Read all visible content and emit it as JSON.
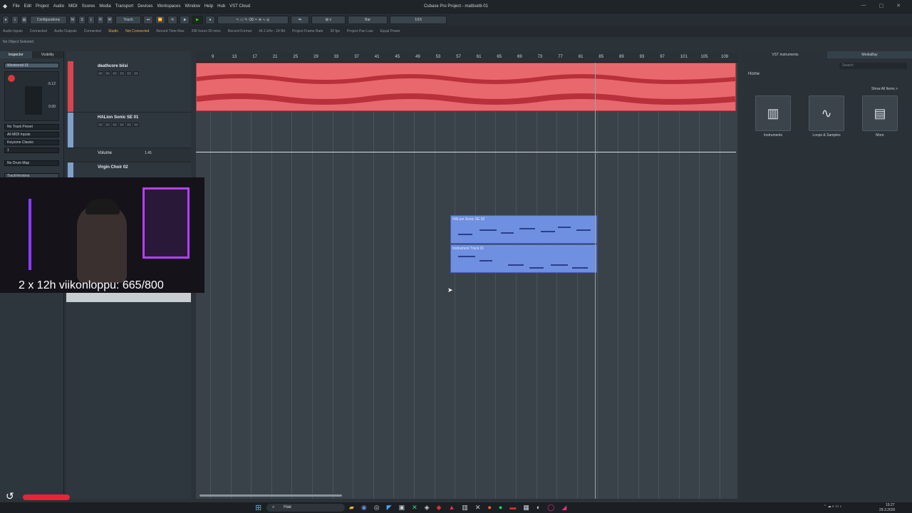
{
  "window": {
    "title": "Cubase Pro Project - mattisetti-01",
    "controls": [
      "—",
      "▢",
      "✕"
    ]
  },
  "menu": [
    "File",
    "Edit",
    "Project",
    "Audio",
    "MIDI",
    "Scores",
    "Media",
    "Transport",
    "Devices",
    "Workspaces",
    "Window",
    "Help",
    "Hub",
    "VST Cloud"
  ],
  "toolbar": {
    "configurations": "Configurations",
    "touch": "Touch",
    "snap_type": "Bar",
    "quantize": "1/16"
  },
  "status_line": {
    "audio_inputs": "Audio Inputs",
    "connected_1": "Connected",
    "audio_outputs": "Audio Outputs",
    "connected_2": "Connected",
    "studio": "Studio",
    "not_connected": "Not Connected",
    "record_time": "Record Time Max",
    "record_time_value": "296 hours 00 mins",
    "record_format": "Record Format",
    "record_format_value": "44.1 kHz - 24 Bit",
    "frame_rate": "Project Frame Rate",
    "frame_rate_value": "30 fps",
    "pan_law": "Project Pan Law",
    "pan_law_value": "Equal Power"
  },
  "selection_info": "No Object Selected",
  "inspector": {
    "tab_inspector": "Inspector",
    "tab_visibility": "Visibility",
    "track_name": "Westwood 01",
    "volume_value": "-5.12",
    "pan_value": "0.00",
    "no_track_preset": "No Track Preset",
    "midi_inputs": "All MIDI Inputs",
    "keyzone": "Keyzone Classic",
    "channel": "1",
    "no_drum_map": "No Drum Map",
    "track_versions": "TrackVersions"
  },
  "tracks": [
    {
      "name": "deathcore biisi",
      "color": "#d9454f"
    },
    {
      "name": "HALion Sonic SE 01",
      "color": "#7fa0c8"
    },
    {
      "name": "Volume",
      "automation_value": "1.45"
    },
    {
      "name": "Virgin Choir 02",
      "color": "#7fa0c8"
    }
  ],
  "ruler_ticks": [
    "9",
    "13",
    "17",
    "21",
    "25",
    "29",
    "33",
    "37",
    "41",
    "45",
    "49",
    "53",
    "57",
    "61",
    "65",
    "69",
    "73",
    "77",
    "81",
    "85",
    "89",
    "93",
    "97",
    "101",
    "105",
    "109"
  ],
  "parts": [
    {
      "label": "HALion Sonic SE 02"
    },
    {
      "label": "Instrument Track 01"
    }
  ],
  "right_panel": {
    "tab_vst": "VST Instruments",
    "tab_mediabay": "MediaBay",
    "search_placeholder": "Search",
    "home": "Home",
    "show_all": "Show All Items >",
    "tiles": [
      {
        "label": "Instruments",
        "icon": "piano-icon"
      },
      {
        "label": "Loops & Samples",
        "icon": "waveform-icon"
      },
      {
        "label": "More",
        "icon": "box-icon"
      }
    ]
  },
  "overlay": {
    "text": "2 x 12h viikonloppu: 665/800"
  },
  "taskbar": {
    "search": "Hae",
    "time": "19.27",
    "date": "29.3.2026"
  }
}
